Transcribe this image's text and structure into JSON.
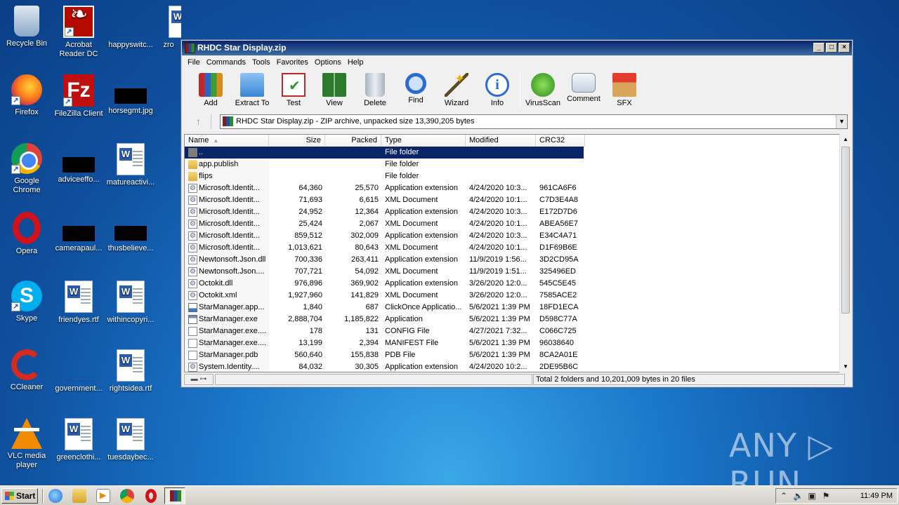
{
  "desktop": {
    "icons": [
      {
        "label": "Recycle Bin"
      },
      {
        "label": "Acrobat Reader DC"
      },
      {
        "label": "happyswitc..."
      },
      {
        "label": "zro"
      },
      {
        "label": "Firefox"
      },
      {
        "label": "FileZilla Client"
      },
      {
        "label": "horsegmt.jpg"
      },
      {
        "label": "Google Chrome"
      },
      {
        "label": "adviceeffo..."
      },
      {
        "label": "matureactivi..."
      },
      {
        "label": "Opera"
      },
      {
        "label": "camerapaul..."
      },
      {
        "label": "thusbelieve..."
      },
      {
        "label": "Skype"
      },
      {
        "label": "friendyes.rtf"
      },
      {
        "label": "withincopyri..."
      },
      {
        "label": "CCleaner"
      },
      {
        "label": "government..."
      },
      {
        "label": "rightsidea.rtf"
      },
      {
        "label": "VLC media player"
      },
      {
        "label": "greenclothi..."
      },
      {
        "label": "tuesdaybec..."
      }
    ]
  },
  "window": {
    "title": "RHDC Star Display.zip",
    "controls": {
      "minimize": "_",
      "maximize": "□",
      "close": "×"
    },
    "menu": [
      "File",
      "Commands",
      "Tools",
      "Favorites",
      "Options",
      "Help"
    ],
    "toolbar": [
      {
        "label": "Add",
        "icon": "add-icon"
      },
      {
        "label": "Extract To",
        "icon": "extract-icon"
      },
      {
        "label": "Test",
        "icon": "test-icon"
      },
      {
        "label": "View",
        "icon": "view-icon"
      },
      {
        "label": "Delete",
        "icon": "delete-icon"
      },
      {
        "label": "Find",
        "icon": "find-icon"
      },
      {
        "label": "Wizard",
        "icon": "wizard-icon"
      },
      {
        "label": "Info",
        "icon": "info-icon"
      },
      {
        "label": "VirusScan",
        "icon": "virusscan-icon"
      },
      {
        "label": "Comment",
        "icon": "comment-icon"
      },
      {
        "label": "SFX",
        "icon": "sfx-icon"
      }
    ],
    "address": {
      "up_glyph": "↑",
      "path": "RHDC Star Display.zip - ZIP archive, unpacked size 13,390,205 bytes",
      "dropdown_glyph": "▼"
    },
    "columns": {
      "name": "Name",
      "size": "Size",
      "packed": "Packed",
      "type": "Type",
      "modified": "Modified",
      "crc": "CRC32"
    },
    "files": [
      {
        "icon": "upfolder",
        "name": "..",
        "size": "",
        "packed": "",
        "type": "File folder",
        "modified": "",
        "crc": ""
      },
      {
        "icon": "folder",
        "name": "app.publish",
        "size": "",
        "packed": "",
        "type": "File folder",
        "modified": "",
        "crc": ""
      },
      {
        "icon": "folder",
        "name": "flips",
        "size": "",
        "packed": "",
        "type": "File folder",
        "modified": "",
        "crc": ""
      },
      {
        "icon": "dll",
        "name": "Microsoft.Identit...",
        "size": "64,360",
        "packed": "25,570",
        "type": "Application extension",
        "modified": "4/24/2020 10:3...",
        "crc": "961CA6F6"
      },
      {
        "icon": "dll",
        "name": "Microsoft.Identit...",
        "size": "71,693",
        "packed": "6,615",
        "type": "XML Document",
        "modified": "4/24/2020 10:1...",
        "crc": "C7D3E4A8"
      },
      {
        "icon": "dll",
        "name": "Microsoft.Identit...",
        "size": "24,952",
        "packed": "12,364",
        "type": "Application extension",
        "modified": "4/24/2020 10:3...",
        "crc": "E172D7D6"
      },
      {
        "icon": "dll",
        "name": "Microsoft.Identit...",
        "size": "25,424",
        "packed": "2,067",
        "type": "XML Document",
        "modified": "4/24/2020 10:1...",
        "crc": "ABEA56E7"
      },
      {
        "icon": "dll",
        "name": "Microsoft.Identit...",
        "size": "859,512",
        "packed": "302,009",
        "type": "Application extension",
        "modified": "4/24/2020 10:3...",
        "crc": "E34C4A71"
      },
      {
        "icon": "dll",
        "name": "Microsoft.Identit...",
        "size": "1,013,621",
        "packed": "80,643",
        "type": "XML Document",
        "modified": "4/24/2020 10:1...",
        "crc": "D1F69B6E"
      },
      {
        "icon": "dll",
        "name": "Newtonsoft.Json.dll",
        "size": "700,336",
        "packed": "263,411",
        "type": "Application extension",
        "modified": "11/9/2019 1:56...",
        "crc": "3D2CD95A"
      },
      {
        "icon": "dll",
        "name": "Newtonsoft.Json....",
        "size": "707,721",
        "packed": "54,092",
        "type": "XML Document",
        "modified": "11/9/2019 1:51...",
        "crc": "325496ED"
      },
      {
        "icon": "dll",
        "name": "Octokit.dll",
        "size": "976,896",
        "packed": "369,902",
        "type": "Application extension",
        "modified": "3/26/2020 12:0...",
        "crc": "545C5E45"
      },
      {
        "icon": "dll",
        "name": "Octokit.xml",
        "size": "1,927,960",
        "packed": "141,829",
        "type": "XML Document",
        "modified": "3/26/2020 12:0...",
        "crc": "7585ACE2"
      },
      {
        "icon": "app",
        "name": "StarManager.app...",
        "size": "1,840",
        "packed": "687",
        "type": "ClickOnce Applicatio...",
        "modified": "5/6/2021 1:39 PM",
        "crc": "18FD1ECA"
      },
      {
        "icon": "exe",
        "name": "StarManager.exe",
        "size": "2,888,704",
        "packed": "1,185,822",
        "type": "Application",
        "modified": "5/6/2021 1:39 PM",
        "crc": "D598C77A"
      },
      {
        "icon": "file",
        "name": "StarManager.exe....",
        "size": "178",
        "packed": "131",
        "type": "CONFIG File",
        "modified": "4/27/2021 7:32...",
        "crc": "C066C725"
      },
      {
        "icon": "file",
        "name": "StarManager.exe....",
        "size": "13,199",
        "packed": "2,394",
        "type": "MANIFEST File",
        "modified": "5/6/2021 1:39 PM",
        "crc": "96038640"
      },
      {
        "icon": "file",
        "name": "StarManager.pdb",
        "size": "560,640",
        "packed": "155,838",
        "type": "PDB File",
        "modified": "5/6/2021 1:39 PM",
        "crc": "8CA2A01E"
      },
      {
        "icon": "dll",
        "name": "System.Identity....",
        "size": "84,032",
        "packed": "30,305",
        "type": "Application extension",
        "modified": "4/24/2020 10:2...",
        "crc": "2DE95B6C"
      }
    ],
    "status": {
      "lock_glyph": "▬ ⊶",
      "text": "Total 2 folders and 10,201,009 bytes in 20 files"
    }
  },
  "watermark": "ANY ▷ RUN",
  "taskbar": {
    "start_label": "Start",
    "clock": "11:49 PM",
    "tray_icons": [
      "chevron-up-icon",
      "volume-icon",
      "network-icon",
      "flag-icon"
    ]
  }
}
